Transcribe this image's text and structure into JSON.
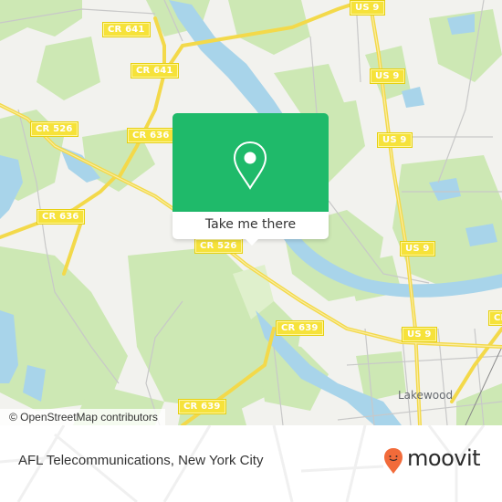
{
  "map": {
    "road_labels": [
      {
        "id": "cr641-top",
        "text": "CR 641"
      },
      {
        "id": "cr641-mid",
        "text": "CR 641"
      },
      {
        "id": "cr526-left",
        "text": "CR 526"
      },
      {
        "id": "cr636-mid",
        "text": "CR 636"
      },
      {
        "id": "cr636-left",
        "text": "CR 636"
      },
      {
        "id": "cr526-center",
        "text": "CR 526"
      },
      {
        "id": "cr639-mid",
        "text": "CR 639"
      },
      {
        "id": "cr639-low",
        "text": "CR 639"
      },
      {
        "id": "us9-top",
        "text": "US 9"
      },
      {
        "id": "us9-a",
        "text": "US 9"
      },
      {
        "id": "us9-b",
        "text": "US 9"
      },
      {
        "id": "us9-c",
        "text": "US 9"
      },
      {
        "id": "us9-d",
        "text": "US 9"
      },
      {
        "id": "cr-right",
        "text": "CR"
      }
    ],
    "place_labels": [
      {
        "id": "lakewood",
        "text": "Lakewood"
      }
    ],
    "attribution": "© OpenStreetMap contributors",
    "colors": {
      "land": "#f2f2ee",
      "park": "#cde8b4",
      "water": "#a8d4ea",
      "road": "#f6e23a",
      "minor_road": "#c8c8c8"
    }
  },
  "popup": {
    "button_label": "Take me there",
    "icon": "map-pin-icon",
    "accent_color": "#1fba6a"
  },
  "footer": {
    "place_title": "AFL Telecommunications, New York City",
    "brand": "moovit",
    "brand_color": "#f26b3a"
  }
}
